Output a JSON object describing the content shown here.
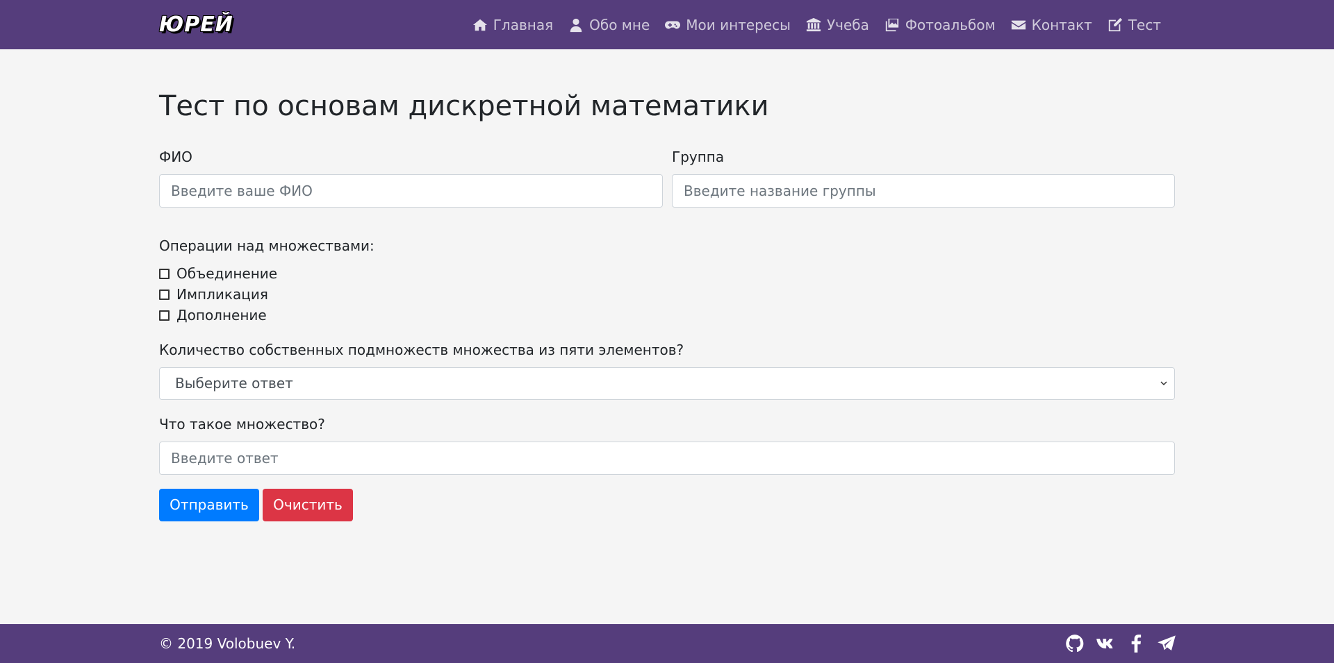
{
  "brand": "ЮРЕЙ",
  "nav": [
    {
      "label": "Главная",
      "icon": "home-icon"
    },
    {
      "label": "Обо мне",
      "icon": "user-icon"
    },
    {
      "label": "Мои интересы",
      "icon": "gamepad-icon"
    },
    {
      "label": "Учеба",
      "icon": "university-icon"
    },
    {
      "label": "Фотоальбом",
      "icon": "photo-album-icon"
    },
    {
      "label": "Контакт",
      "icon": "envelope-icon"
    },
    {
      "label": "Тест",
      "icon": "edit-icon"
    }
  ],
  "title": "Тест по основам дискретной математики",
  "form": {
    "fio_label": "ФИО",
    "fio_placeholder": "Введите ваше ФИО",
    "group_label": "Группа",
    "group_placeholder": "Введите название группы",
    "ops_label": "Операции над множествами:",
    "ops_options": [
      "Объединение",
      "Импликация",
      "Дополнение"
    ],
    "subsets_label": "Количество собственных подмножеств множества из пяти элементов?",
    "subsets_selected": "Выберите ответ",
    "set_label": "Что такое множество?",
    "set_placeholder": "Введите ответ",
    "submit_label": "Отправить",
    "clear_label": "Очистить"
  },
  "footer": {
    "copyright": "© 2019 Volobuev Y.",
    "socials": [
      "github-icon",
      "vk-icon",
      "facebook-icon",
      "telegram-icon"
    ]
  },
  "colors": {
    "navbar": "#553d7c",
    "primary": "#007bff",
    "danger": "#dc3545",
    "background": "#f5f5f5"
  }
}
